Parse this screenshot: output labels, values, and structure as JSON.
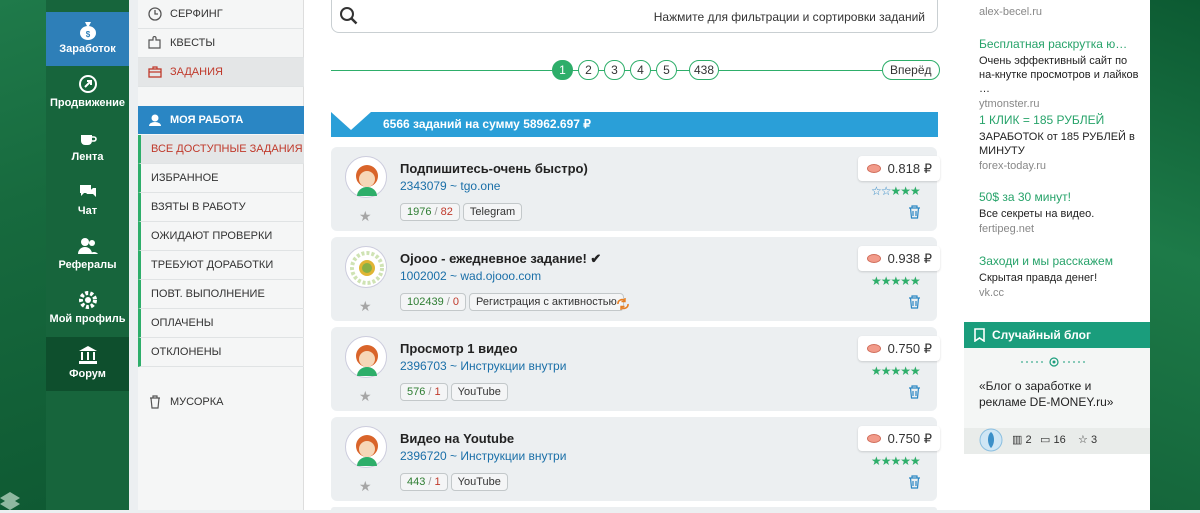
{
  "iconbar": [
    {
      "label": "Заработок",
      "icon": "money-bag-icon"
    },
    {
      "label": "Продвижение",
      "icon": "promotion-icon"
    },
    {
      "label": "Лента",
      "icon": "coffee-icon"
    },
    {
      "label": "Чат",
      "icon": "chat-icon"
    },
    {
      "label": "Рефералы",
      "icon": "users-icon"
    },
    {
      "label": "Мой профиль",
      "icon": "gear-icon"
    },
    {
      "label": "Форум",
      "icon": "bank-icon"
    }
  ],
  "menu": {
    "top": [
      {
        "label": "СЕРФИНГ",
        "icon": "clock-icon"
      },
      {
        "label": "КВЕСТЫ",
        "icon": "puzzle-icon"
      },
      {
        "label": "ЗАДАНИЯ",
        "icon": "briefcase-icon"
      }
    ],
    "head": "МОЯ РАБОТА",
    "work": [
      "ВСЕ ДОСТУПНЫЕ ЗАДАНИЯ",
      "ИЗБРАННОЕ",
      "ВЗЯТЫ В РАБОТУ",
      "ОЖИДАЮТ ПРОВЕРКИ",
      "ТРЕБУЮТ ДОРАБОТКИ",
      "ПОВТ. ВЫПОЛНЕНИЕ",
      "ОПЛАЧЕНЫ",
      "ОТКЛОНЕНЫ"
    ],
    "trash": "МУСОРКА"
  },
  "search": {
    "text": "Нажмите для фильтрации и сортировки заданий"
  },
  "pager": {
    "pages": [
      "1",
      "2",
      "3",
      "4",
      "5",
      "438"
    ],
    "current": "1",
    "next": "Вперёд"
  },
  "banner": {
    "prefix": "6566 заданий на сумму",
    "amount": "58962.697 ₽"
  },
  "tasks": [
    {
      "title": "Подпишитесь-очень быстро)",
      "sub": "2343079 ~ tgo.one",
      "green": "1976",
      "red": "82",
      "tag": "Telegram",
      "price": "0.818 ₽",
      "stars_filled": 3,
      "repeat": false
    },
    {
      "title": "Ojooo - ежедневное задание! ✔",
      "sub": "1002002 ~ wad.ojooo.com",
      "green": "102439",
      "red": "0",
      "tag": "Регистрация с активностью",
      "price": "0.938 ₽",
      "stars_filled": 5,
      "repeat": true
    },
    {
      "title": "Просмотр 1 видео",
      "sub": "2396703 ~ Инструкции внутри",
      "green": "576",
      "red": "1",
      "tag": "YouTube",
      "price": "0.750 ₽",
      "stars_filled": 5,
      "repeat": false
    },
    {
      "title": "Видео на Youtube",
      "sub": "2396720 ~ Инструкции внутри",
      "green": "443",
      "red": "1",
      "tag": "YouTube",
      "price": "0.750 ₽",
      "stars_filled": 5,
      "repeat": false
    }
  ],
  "ads": [
    {
      "title": "",
      "desc": "",
      "url": "alex-becel.ru"
    },
    {
      "title": "Бесплатная раскрутка ю…",
      "desc": "Очень эффективный сайт по на-кнутке просмотров и лайков …",
      "url": "ytmonster.ru"
    },
    {
      "title": "1 КЛИК = 185 РУБЛЕЙ",
      "desc": "ЗАРАБОТОК от 185 РУБЛЕЙ в МИНУТУ",
      "url": "forex-today.ru"
    },
    {
      "title": "50$ за 30 минут!",
      "desc": "Все секреты на видео.",
      "url": "fertipeg.net"
    },
    {
      "title": "Заходи и мы расскажем",
      "desc": "Скрытая правда денег!",
      "url": "vk.cc"
    }
  ],
  "blog": {
    "head": "Случайный блог",
    "text": "«Блог о заработке и рекламе DE-MONEY.ru»",
    "books": "2",
    "comments": "16",
    "stars": "3"
  },
  "colors": {
    "green": "#2eae6a",
    "blue": "#2a86c4",
    "banner": "#2a9fd8",
    "red": "#c0392b"
  }
}
